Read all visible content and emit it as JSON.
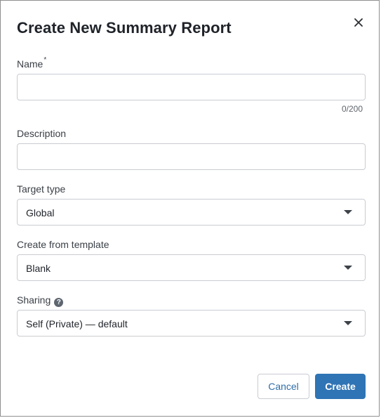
{
  "dialog": {
    "title": "Create New Summary Report",
    "close_icon": "close-icon"
  },
  "form": {
    "name": {
      "label": "Name",
      "required_mark": "*",
      "value": "",
      "placeholder": "",
      "counter": "0/200"
    },
    "description": {
      "label": "Description",
      "value": "",
      "placeholder": ""
    },
    "target_type": {
      "label": "Target type",
      "selected": "Global"
    },
    "template": {
      "label": "Create from template",
      "selected": "Blank"
    },
    "sharing": {
      "label": "Sharing",
      "help_icon": "help-icon",
      "selected": "Self (Private) — default"
    }
  },
  "actions": {
    "cancel_label": "Cancel",
    "create_label": "Create"
  },
  "colors": {
    "primary": "#2f74b5",
    "border": "#c9ccd1",
    "text": "#1f2329"
  }
}
